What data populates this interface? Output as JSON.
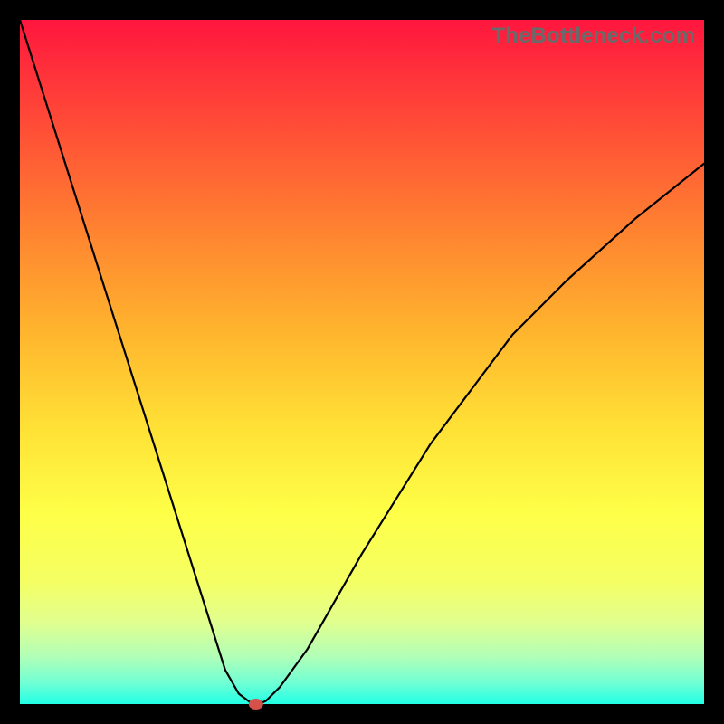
{
  "watermark": "TheBottleneck.com",
  "chart_data": {
    "type": "line",
    "title": "",
    "xlabel": "",
    "ylabel": "",
    "xlim": [
      0,
      100
    ],
    "ylim": [
      0,
      100
    ],
    "series": [
      {
        "name": "bottleneck-curve",
        "x": [
          0,
          3,
          6,
          9,
          12,
          15,
          18,
          21,
          24,
          27,
          30,
          32,
          34,
          35,
          36,
          38,
          42,
          46,
          50,
          55,
          60,
          66,
          72,
          80,
          90,
          100
        ],
        "y": [
          100,
          90.5,
          81,
          71.5,
          62,
          52.5,
          43,
          33.5,
          24,
          14.5,
          5,
          1.5,
          0,
          0,
          0.5,
          2.5,
          8,
          15,
          22,
          30,
          38,
          46,
          54,
          62,
          71,
          79
        ]
      }
    ],
    "markers": [
      {
        "name": "optimal-point",
        "x": 34.5,
        "y": 0
      }
    ]
  }
}
